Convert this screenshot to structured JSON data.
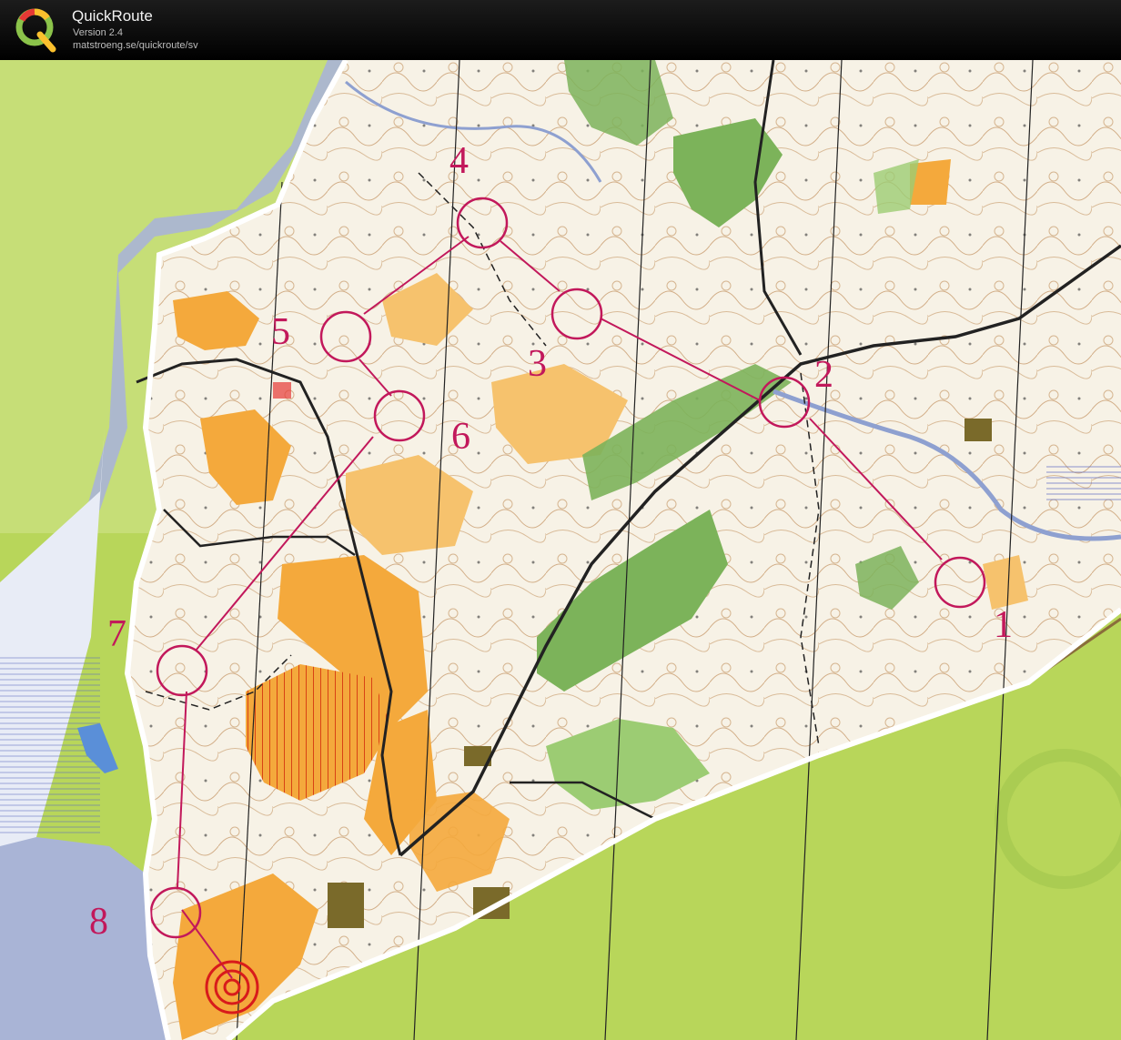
{
  "app": {
    "title": "QuickRoute",
    "version": "Version 2.4",
    "url": "matstroeng.se/quickroute/sv"
  },
  "map": {
    "course_color": "#c2185b",
    "start_color": "#d81b1b",
    "controls": [
      {
        "number": "1"
      },
      {
        "number": "2"
      },
      {
        "number": "3"
      },
      {
        "number": "4"
      },
      {
        "number": "5"
      },
      {
        "number": "6"
      },
      {
        "number": "7"
      },
      {
        "number": "8"
      }
    ]
  },
  "colors": {
    "header_bg": "#000000",
    "green_background": "#a9cf45",
    "water": "#a9b4d6",
    "open_land": "#f4a93c",
    "forest_green": "#7cb35a",
    "map_paper": "#f7f2e6"
  }
}
